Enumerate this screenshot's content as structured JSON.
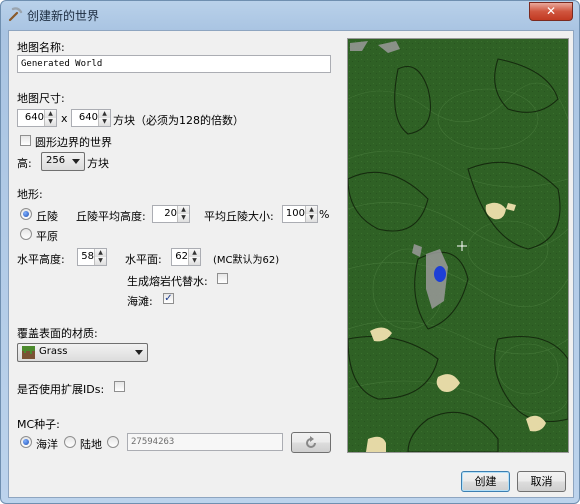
{
  "window": {
    "title": "创建新的世界",
    "close_label": "✕"
  },
  "map_name": {
    "label": "地图名称:",
    "value": "Generated World"
  },
  "map_size": {
    "label": "地图尺寸:",
    "width": "640",
    "height": "640",
    "separator": "x",
    "suffix": "方块（必须为128的倍数）",
    "circular_label": "圆形边界的世界",
    "circular_checked": false,
    "height_label": "高:",
    "world_height": "256",
    "height_suffix": "方块"
  },
  "terrain": {
    "label": "地形:",
    "hills_label": "丘陵",
    "hills_selected": true,
    "flat_label": "平原",
    "flat_selected": false,
    "avg_hill_height_label": "丘陵平均高度:",
    "avg_hill_height": "20",
    "avg_hill_size_label": "平均丘陵大小:",
    "avg_hill_size": "100",
    "avg_hill_size_unit": "%",
    "level_height_label": "水平高度:",
    "level_height": "58",
    "water_level_label": "水平面:",
    "water_level": "62",
    "water_level_note": "(MC默认为62)",
    "lava_label": "生成熔岩代替水:",
    "lava_checked": false,
    "beaches_label": "海滩:",
    "beaches_checked": true
  },
  "surface": {
    "label": "覆盖表面的材质:",
    "material": "Grass",
    "material_icon": "grass-block-icon"
  },
  "extended_ids": {
    "label": "是否使用扩展IDs:",
    "checked": false
  },
  "seed": {
    "label": "MC种子:",
    "ocean_label": "海洋",
    "ocean_selected": true,
    "land_label": "陆地",
    "land_selected": false,
    "custom_selected": false,
    "value": "27594263",
    "refresh_icon": "refresh-icon"
  },
  "buttons": {
    "create": "创建",
    "cancel": "取消"
  },
  "colors": {
    "map_grass": "#2f6125",
    "map_contour": "#1a3312",
    "sand": "#e5d9a6",
    "water": "#1d3fd6",
    "stone": "#9a9a9a"
  }
}
